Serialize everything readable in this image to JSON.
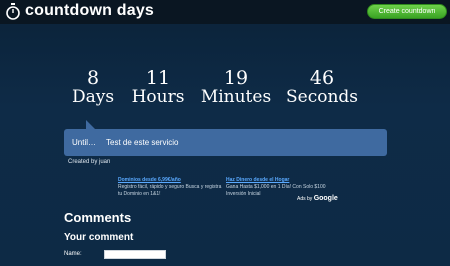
{
  "header": {
    "brand": "countdown days",
    "create_button_label": "Create countdown",
    "logo_icon": "stopwatch-icon"
  },
  "countdown": {
    "days": {
      "value": "8",
      "label": "Days"
    },
    "hours": {
      "value": "11",
      "label": "Hours"
    },
    "minutes": {
      "value": "19",
      "label": "Minutes"
    },
    "seconds": {
      "value": "46",
      "label": "Seconds"
    }
  },
  "until": {
    "label": "Until…",
    "text": "Test de este servicio",
    "color": "#3f6aa0"
  },
  "created_by": "Created by juan",
  "ads": [
    {
      "title": "Dominios desde 6,99€/año",
      "body": "Registro fácil, rápido y seguro Busca y registra tu Dominio en 1&1!"
    },
    {
      "title": "Haz Dinero desde el Hogar",
      "body": "Gana Hasta $1,000 en 1 Día! Con Solo $100 Inversión Inicial"
    }
  ],
  "ads_by": {
    "prefix": "Ads by",
    "brand": "Google"
  },
  "comments": {
    "heading": "Comments",
    "your_comment": "Your comment",
    "name_label": "Name:",
    "name_value": ""
  },
  "colors": {
    "background": "#0e2b47",
    "accent_green": "#3aa324",
    "link_blue": "#5aa9ff"
  }
}
